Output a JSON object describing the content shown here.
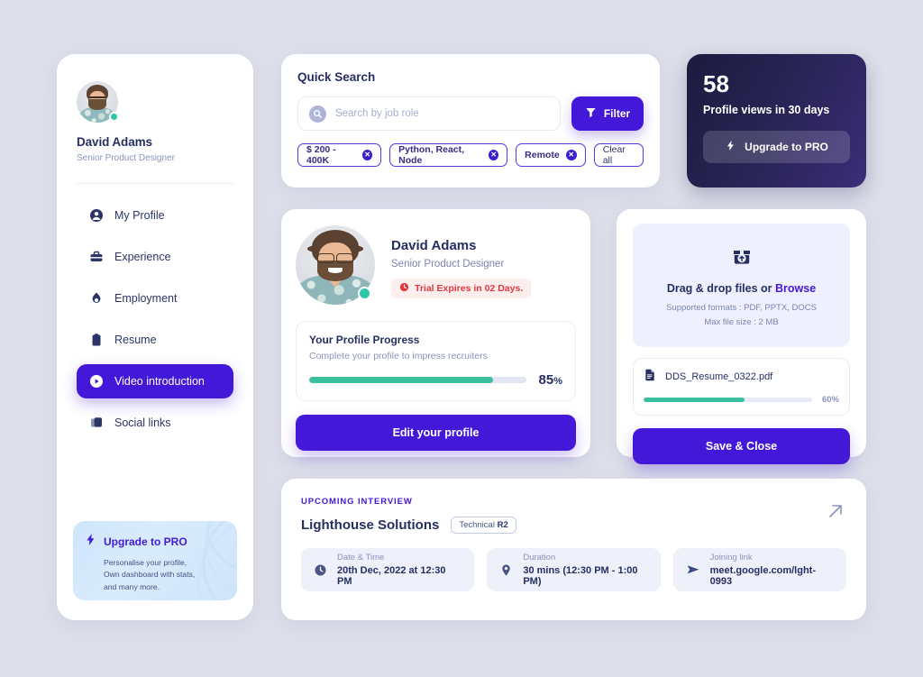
{
  "sidebar": {
    "user": {
      "name": "David Adams",
      "role": "Senior Product Designer"
    },
    "items": [
      {
        "label": "My Profile",
        "icon": "user-circle-icon",
        "active": false
      },
      {
        "label": "Experience",
        "icon": "briefcase-icon",
        "active": false
      },
      {
        "label": "Employment",
        "icon": "flame-icon",
        "active": false
      },
      {
        "label": "Resume",
        "icon": "clipboard-icon",
        "active": false
      },
      {
        "label": "Video introduction",
        "icon": "play-circle-icon",
        "active": true
      },
      {
        "label": "Social links",
        "icon": "layers-icon",
        "active": false
      }
    ],
    "promo": {
      "title": "Upgrade to PRO",
      "icon": "bolt-icon",
      "lines": [
        "Personalise your profile,",
        "Own dashboard with stats,",
        "and many more."
      ]
    }
  },
  "quick_search": {
    "title": "Quick Search",
    "search_placeholder": "Search by job role",
    "search_value": "",
    "search_icon": "search-icon",
    "filter_label": "Filter",
    "filter_icon": "funnel-icon",
    "chips": [
      {
        "label": "$ 200 - 400K",
        "removable": true
      },
      {
        "label": "Python, React, Node",
        "removable": true
      },
      {
        "label": "Remote",
        "removable": true
      },
      {
        "label": "Clear all",
        "removable": false
      }
    ]
  },
  "views_card": {
    "count": "58",
    "caption_prefix": "Profile views in ",
    "caption_strong": "30 days",
    "button_label": "Upgrade to PRO",
    "button_icon": "bolt-icon",
    "accent": "#4318d8"
  },
  "profile_card": {
    "name": "David Adams",
    "role": "Senior Product Designer",
    "trial_text": "Trial Expires in 02 Days.",
    "trial_icon": "clock-icon",
    "trial_color": "#e0383e",
    "progress": {
      "title": "Your Profile Progress",
      "subtitle": "Complete your profile to impress recruiters",
      "percent_number": "85",
      "percent_symbol": "%",
      "value": 85,
      "bar_color": "#3bbf9e"
    },
    "edit_button": "Edit your profile",
    "status": "online"
  },
  "upload_card": {
    "drop_icon": "upload-box-icon",
    "drop_prefix": "Drag & drop files or ",
    "drop_link": "Browse",
    "formats": "Supported formats : PDF, PPTX, DOCS",
    "max_size": "Max file size : 2 MB",
    "file": {
      "icon": "file-icon",
      "name": "DDS_Resume_0322.pdf",
      "percent_label": "60%",
      "value": 60
    },
    "save_button": "Save & Close"
  },
  "interview": {
    "kicker": "UPCOMING INTERVIEW",
    "company": "Lighthouse Solutions",
    "badge_prefix": "Technical ",
    "badge_strong": "R2",
    "open_icon": "arrow-up-right-icon",
    "details": [
      {
        "icon": "clock-icon",
        "label": "Date & Time",
        "value": "20th Dec, 2022 at 12:30 PM"
      },
      {
        "icon": "pin-icon",
        "label": "Duration",
        "value": "30 mins (12:30 PM - 1:00 PM)"
      },
      {
        "icon": "send-icon",
        "label": "Joining link",
        "value": "meet.google.com/lght-0993"
      }
    ]
  }
}
